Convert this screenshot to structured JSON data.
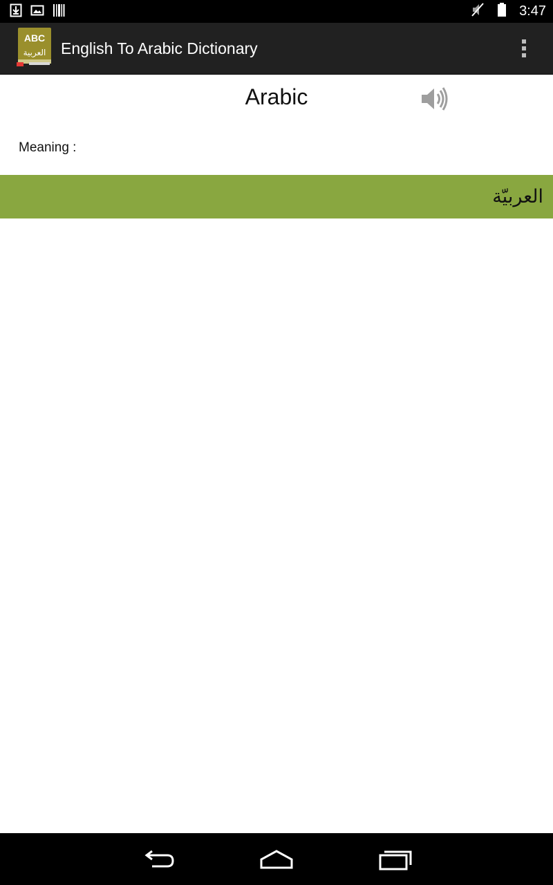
{
  "status_bar": {
    "time": "3:47",
    "icons": [
      "download-icon",
      "image-icon",
      "barcode-icon",
      "muted-icon",
      "battery-icon"
    ]
  },
  "action_bar": {
    "title": "English To Arabic Dictionary",
    "logo_text_top": "ABC",
    "logo_text_bottom": "العربية",
    "logo_color": "#9a8f2c",
    "overflow_icon": "overflow-menu-icon"
  },
  "word": {
    "text": "Arabic",
    "speaker_icon": "speaker-icon"
  },
  "meaning": {
    "label": "Meaning :",
    "translation": "العربيّة",
    "bar_color": "#89a740"
  },
  "nav_bar": {
    "buttons": [
      "back-icon",
      "home-icon",
      "recent-apps-icon"
    ]
  }
}
